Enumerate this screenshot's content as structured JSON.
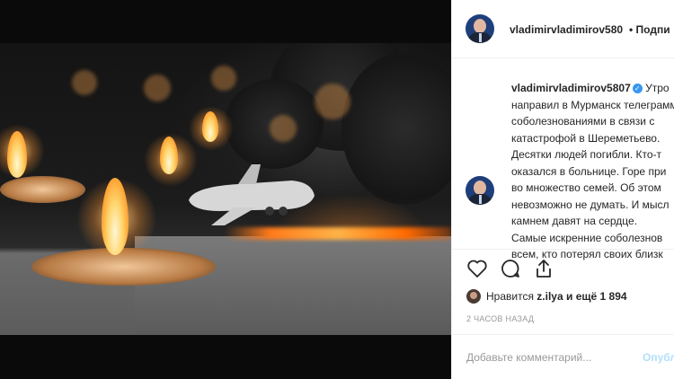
{
  "post": {
    "username_header": "vladimirvladimirov580",
    "follow_label": "• Подпи",
    "caption_username": "vladimirvladimirov5807",
    "caption_lines": [
      "Утро",
      "направил в Мурманск телеграмм",
      "соболезнованиями в связи с",
      "катастрофой в Шереметьево.",
      "Десятки людей погибли. Кто-т",
      "оказался в больнице. Горе при",
      "во множество семей. Об этом",
      "невозможно не думать. И мысл",
      "камнем давят на сердце.",
      "Самые искренние соболезнов",
      "всем, кто потерял своих близк"
    ],
    "likes_prefix": "Нравится",
    "likes_user": "z.ilya",
    "likes_suffix": "и ещё 1 894",
    "time_ago": "2 ЧАСОВ НАЗАД",
    "comment_placeholder": "Добавьте комментарий...",
    "post_button": "Опубл"
  },
  "icons": {
    "like": "heart-icon",
    "comment": "comment-icon",
    "share": "share-icon",
    "verified": "verified-badge-icon"
  },
  "colors": {
    "verified": "#3897f0",
    "post_button": "#b2dffc",
    "text": "#262626",
    "muted": "#999999"
  }
}
